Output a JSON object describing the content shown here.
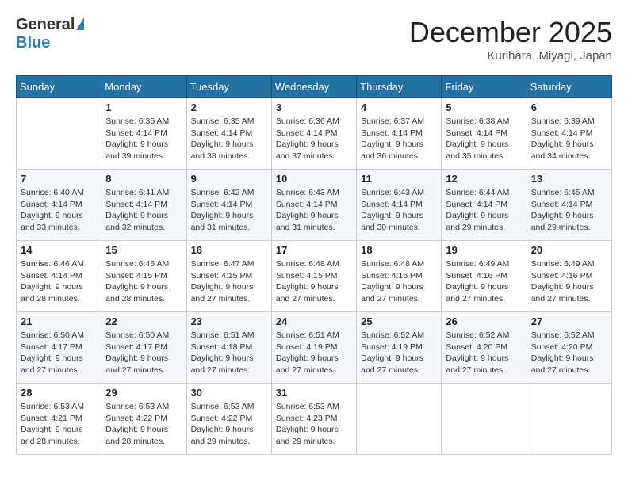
{
  "header": {
    "logo_general": "General",
    "logo_blue": "Blue",
    "month_title": "December 2025",
    "location": "Kurihara, Miyagi, Japan"
  },
  "weekdays": [
    "Sunday",
    "Monday",
    "Tuesday",
    "Wednesday",
    "Thursday",
    "Friday",
    "Saturday"
  ],
  "weeks": [
    [
      {
        "day": "",
        "info": ""
      },
      {
        "day": "1",
        "info": "Sunrise: 6:35 AM\nSunset: 4:14 PM\nDaylight: 9 hours\nand 39 minutes."
      },
      {
        "day": "2",
        "info": "Sunrise: 6:35 AM\nSunset: 4:14 PM\nDaylight: 9 hours\nand 38 minutes."
      },
      {
        "day": "3",
        "info": "Sunrise: 6:36 AM\nSunset: 4:14 PM\nDaylight: 9 hours\nand 37 minutes."
      },
      {
        "day": "4",
        "info": "Sunrise: 6:37 AM\nSunset: 4:14 PM\nDaylight: 9 hours\nand 36 minutes."
      },
      {
        "day": "5",
        "info": "Sunrise: 6:38 AM\nSunset: 4:14 PM\nDaylight: 9 hours\nand 35 minutes."
      },
      {
        "day": "6",
        "info": "Sunrise: 6:39 AM\nSunset: 4:14 PM\nDaylight: 9 hours\nand 34 minutes."
      }
    ],
    [
      {
        "day": "7",
        "info": "Sunrise: 6:40 AM\nSunset: 4:14 PM\nDaylight: 9 hours\nand 33 minutes."
      },
      {
        "day": "8",
        "info": "Sunrise: 6:41 AM\nSunset: 4:14 PM\nDaylight: 9 hours\nand 32 minutes."
      },
      {
        "day": "9",
        "info": "Sunrise: 6:42 AM\nSunset: 4:14 PM\nDaylight: 9 hours\nand 31 minutes."
      },
      {
        "day": "10",
        "info": "Sunrise: 6:43 AM\nSunset: 4:14 PM\nDaylight: 9 hours\nand 31 minutes."
      },
      {
        "day": "11",
        "info": "Sunrise: 6:43 AM\nSunset: 4:14 PM\nDaylight: 9 hours\nand 30 minutes."
      },
      {
        "day": "12",
        "info": "Sunrise: 6:44 AM\nSunset: 4:14 PM\nDaylight: 9 hours\nand 29 minutes."
      },
      {
        "day": "13",
        "info": "Sunrise: 6:45 AM\nSunset: 4:14 PM\nDaylight: 9 hours\nand 29 minutes."
      }
    ],
    [
      {
        "day": "14",
        "info": "Sunrise: 6:46 AM\nSunset: 4:14 PM\nDaylight: 9 hours\nand 28 minutes."
      },
      {
        "day": "15",
        "info": "Sunrise: 6:46 AM\nSunset: 4:15 PM\nDaylight: 9 hours\nand 28 minutes."
      },
      {
        "day": "16",
        "info": "Sunrise: 6:47 AM\nSunset: 4:15 PM\nDaylight: 9 hours\nand 27 minutes."
      },
      {
        "day": "17",
        "info": "Sunrise: 6:48 AM\nSunset: 4:15 PM\nDaylight: 9 hours\nand 27 minutes."
      },
      {
        "day": "18",
        "info": "Sunrise: 6:48 AM\nSunset: 4:16 PM\nDaylight: 9 hours\nand 27 minutes."
      },
      {
        "day": "19",
        "info": "Sunrise: 6:49 AM\nSunset: 4:16 PM\nDaylight: 9 hours\nand 27 minutes."
      },
      {
        "day": "20",
        "info": "Sunrise: 6:49 AM\nSunset: 4:16 PM\nDaylight: 9 hours\nand 27 minutes."
      }
    ],
    [
      {
        "day": "21",
        "info": "Sunrise: 6:50 AM\nSunset: 4:17 PM\nDaylight: 9 hours\nand 27 minutes."
      },
      {
        "day": "22",
        "info": "Sunrise: 6:50 AM\nSunset: 4:17 PM\nDaylight: 9 hours\nand 27 minutes."
      },
      {
        "day": "23",
        "info": "Sunrise: 6:51 AM\nSunset: 4:18 PM\nDaylight: 9 hours\nand 27 minutes."
      },
      {
        "day": "24",
        "info": "Sunrise: 6:51 AM\nSunset: 4:19 PM\nDaylight: 9 hours\nand 27 minutes."
      },
      {
        "day": "25",
        "info": "Sunrise: 6:52 AM\nSunset: 4:19 PM\nDaylight: 9 hours\nand 27 minutes."
      },
      {
        "day": "26",
        "info": "Sunrise: 6:52 AM\nSunset: 4:20 PM\nDaylight: 9 hours\nand 27 minutes."
      },
      {
        "day": "27",
        "info": "Sunrise: 6:52 AM\nSunset: 4:20 PM\nDaylight: 9 hours\nand 27 minutes."
      }
    ],
    [
      {
        "day": "28",
        "info": "Sunrise: 6:53 AM\nSunset: 4:21 PM\nDaylight: 9 hours\nand 28 minutes."
      },
      {
        "day": "29",
        "info": "Sunrise: 6:53 AM\nSunset: 4:22 PM\nDaylight: 9 hours\nand 28 minutes."
      },
      {
        "day": "30",
        "info": "Sunrise: 6:53 AM\nSunset: 4:22 PM\nDaylight: 9 hours\nand 29 minutes."
      },
      {
        "day": "31",
        "info": "Sunrise: 6:53 AM\nSunset: 4:23 PM\nDaylight: 9 hours\nand 29 minutes."
      },
      {
        "day": "",
        "info": ""
      },
      {
        "day": "",
        "info": ""
      },
      {
        "day": "",
        "info": ""
      }
    ]
  ]
}
